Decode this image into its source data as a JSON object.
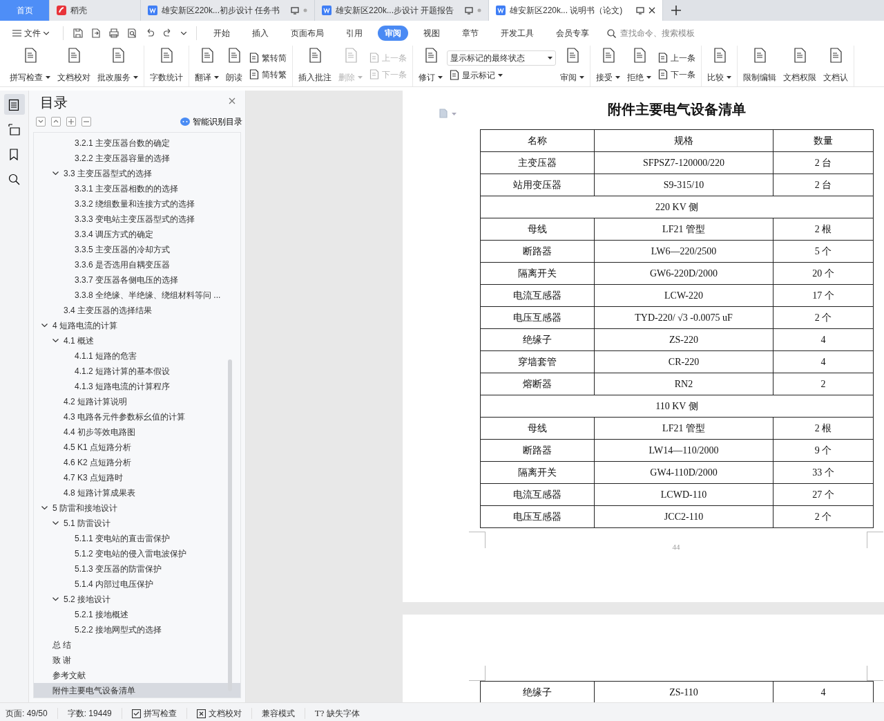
{
  "tabs": [
    {
      "kind": "home",
      "label": "首页",
      "selected": false
    },
    {
      "kind": "app",
      "label": "稻壳",
      "selected": false
    },
    {
      "kind": "doc",
      "label": "雄安新区220k...初步设计 任务书",
      "selected": false
    },
    {
      "kind": "doc",
      "label": "雄安新区220k...步设计 开题报告",
      "selected": false
    },
    {
      "kind": "doc",
      "label": "雄安新区220k... 说明书（论文)",
      "selected": true
    }
  ],
  "menubar": {
    "file": "文件",
    "menus": [
      {
        "label": "开始",
        "selected": false
      },
      {
        "label": "插入",
        "selected": false
      },
      {
        "label": "页面布局",
        "selected": false
      },
      {
        "label": "引用",
        "selected": false
      },
      {
        "label": "审阅",
        "selected": true
      },
      {
        "label": "视图",
        "selected": false
      },
      {
        "label": "章节",
        "selected": false
      },
      {
        "label": "开发工具",
        "selected": false
      },
      {
        "label": "会员专享",
        "selected": false
      }
    ],
    "search": {
      "placeholder": "查找命令、搜索模板"
    }
  },
  "ribbon": {
    "groups": [
      {
        "items": [
          {
            "kind": "big",
            "label": "拼写检查",
            "dropdown": true,
            "disabled": false
          },
          {
            "kind": "big",
            "label": "文档校对",
            "dropdown": false,
            "disabled": false
          },
          {
            "kind": "big",
            "label": "批改服务",
            "dropdown": true,
            "disabled": false
          }
        ]
      },
      {
        "items": [
          {
            "kind": "big",
            "label": "字数统计",
            "dropdown": false,
            "disabled": false
          }
        ]
      },
      {
        "items": [
          {
            "kind": "big",
            "label": "翻译",
            "dropdown": true,
            "disabled": false
          },
          {
            "kind": "big",
            "label": "朗读",
            "dropdown": false,
            "disabled": false
          },
          {
            "kind": "stack",
            "buttons": [
              {
                "label": "繁转简",
                "dropdown": false,
                "disabled": false
              },
              {
                "label": "简转繁",
                "dropdown": false,
                "disabled": false
              }
            ]
          }
        ]
      },
      {
        "items": [
          {
            "kind": "big",
            "label": "插入批注",
            "dropdown": false,
            "disabled": false
          },
          {
            "kind": "big",
            "label": "删除",
            "dropdown": true,
            "disabled": true
          },
          {
            "kind": "stack",
            "buttons": [
              {
                "label": "上一条",
                "dropdown": false,
                "disabled": true
              },
              {
                "label": "下一条",
                "dropdown": false,
                "disabled": true
              }
            ]
          }
        ]
      },
      {
        "items": [
          {
            "kind": "big",
            "label": "修订",
            "dropdown": true,
            "disabled": false
          },
          {
            "kind": "select",
            "value": "显示标记的最终状态",
            "button": {
              "label": "显示标记",
              "dropdown": true
            }
          },
          {
            "kind": "big",
            "label": "审阅",
            "dropdown": true,
            "disabled": false
          }
        ]
      },
      {
        "items": [
          {
            "kind": "big",
            "label": "接受",
            "dropdown": true,
            "disabled": false
          },
          {
            "kind": "big",
            "label": "拒绝",
            "dropdown": true,
            "disabled": false
          },
          {
            "kind": "stack",
            "buttons": [
              {
                "label": "上一条",
                "dropdown": false,
                "disabled": false
              },
              {
                "label": "下一条",
                "dropdown": false,
                "disabled": false
              }
            ]
          }
        ]
      },
      {
        "items": [
          {
            "kind": "big",
            "label": "比较",
            "dropdown": true,
            "disabled": false
          }
        ]
      },
      {
        "items": [
          {
            "kind": "big",
            "label": "限制编辑",
            "dropdown": false,
            "disabled": false
          },
          {
            "kind": "big",
            "label": "文档权限",
            "dropdown": false,
            "disabled": false
          },
          {
            "kind": "big",
            "label": "文档认",
            "dropdown": false,
            "disabled": false
          }
        ]
      }
    ]
  },
  "toc": {
    "title": "目录",
    "smart_button": "智能识别目录",
    "items": [
      {
        "children": [
          {
            "children": [
              {
                "label": "3.2.1  主变压器台数的确定",
                "selected": false
              },
              {
                "label": "3.2.2  主变压器容量的选择",
                "selected": false
              }
            ]
          },
          {
            "label": "3.3  主变压器型式的选择",
            "expanded": true,
            "selected": false,
            "children": [
              {
                "label": "3.3.1  主变压器相数的的选择",
                "selected": false
              },
              {
                "label": "3.3.2 绕组数量和连接方式的选择",
                "selected": false
              },
              {
                "label": "3.3.3 变电站主变压器型式的选择",
                "selected": false
              },
              {
                "label": "3.3.4 调压方式的确定",
                "selected": false
              },
              {
                "label": "3.3.5 主变压器的冷却方式",
                "selected": false
              },
              {
                "label": "3.3.6 是否选用自耦变压器",
                "selected": false
              },
              {
                "label": "3.3.7 变压器各侧电压的选择",
                "selected": false
              },
              {
                "label": "3.3.8 全绝缘、半绝缘、绕组材料等问 ...",
                "selected": false
              }
            ]
          },
          {
            "label": "3.4 主变压器的选择结果",
            "selected": false
          }
        ]
      },
      {
        "label": "4  短路电流的计算",
        "expanded": true,
        "selected": false,
        "children": [
          {
            "label": "4.1  概述",
            "expanded": true,
            "selected": false,
            "children": [
              {
                "label": "4.1.1  短路的危害",
                "selected": false
              },
              {
                "label": "4.1.2  短路计算的基本假设",
                "selected": false
              },
              {
                "label": "4.1.3  短路电流的计算程序",
                "selected": false
              }
            ]
          },
          {
            "label": "4.2  短路计算说明",
            "selected": false
          },
          {
            "label": "4.3  电路各元件参数标幺值的计算",
            "selected": false
          },
          {
            "label": "4.4  初步等效电路图",
            "selected": false
          },
          {
            "label": "4.5 K1 点短路分析",
            "selected": false
          },
          {
            "label": "4.6 K2 点短路分析",
            "selected": false
          },
          {
            "label": "4.7 K3 点短路时",
            "selected": false
          },
          {
            "label": "4.8  短路计算成果表",
            "selected": false
          }
        ]
      },
      {
        "label": "5  防雷和接地设计",
        "expanded": true,
        "selected": false,
        "children": [
          {
            "label": "5.1  防雷设计",
            "expanded": true,
            "selected": false,
            "children": [
              {
                "label": "5.1.1 变电站的直击雷保护",
                "selected": false
              },
              {
                "label": "5.1.2  变电站的侵入雷电波保护",
                "selected": false
              },
              {
                "label": "5.1.3  变压器的防雷保护",
                "selected": false
              },
              {
                "label": "5.1.4 内部过电压保护",
                "selected": false
              }
            ]
          },
          {
            "label": "5.2  接地设计",
            "expanded": true,
            "selected": false,
            "children": [
              {
                "label": "5.2.1  接地概述",
                "selected": false
              },
              {
                "label": "5.2.2  接地网型式的选择",
                "selected": false
              }
            ]
          }
        ]
      },
      {
        "label": "总    结",
        "selected": false
      },
      {
        "label": "致    谢",
        "selected": false
      },
      {
        "label": "参考文献",
        "selected": false
      },
      {
        "label": "附件主要电气设备清单",
        "selected": true
      }
    ]
  },
  "document": {
    "title": "附件主要电气设备清单",
    "rows": [
      {
        "kind": "header",
        "cells": [
          "名称",
          "规格",
          "数量"
        ]
      },
      {
        "kind": "item",
        "cells": [
          "主变压器",
          "SFPSZ7-120000/220",
          "2 台"
        ]
      },
      {
        "kind": "item",
        "cells": [
          "站用变压器",
          "S9-315/10",
          "2 台"
        ]
      },
      {
        "kind": "section",
        "label": "220 KV 侧"
      },
      {
        "kind": "item",
        "cells": [
          "母线",
          "LF21 管型",
          "2 根"
        ]
      },
      {
        "kind": "item",
        "cells": [
          "断路器",
          "LW6—220/2500",
          "5 个"
        ]
      },
      {
        "kind": "item",
        "cells": [
          "隔离开关",
          "GW6-220D/2000",
          "20 个"
        ]
      },
      {
        "kind": "item",
        "cells": [
          "电流互感器",
          "LCW-220",
          "17 个"
        ]
      },
      {
        "kind": "item",
        "cells": [
          "电压互感器",
          "TYD-220/ √3  -0.0075 uF",
          "2 个"
        ]
      },
      {
        "kind": "item",
        "cells": [
          "绝缘子",
          "ZS-220",
          "4"
        ]
      },
      {
        "kind": "item",
        "cells": [
          "穿墙套管",
          "CR-220",
          "4"
        ]
      },
      {
        "kind": "item",
        "cells": [
          "熔断器",
          "RN2",
          "2"
        ]
      },
      {
        "kind": "section",
        "label": "110 KV 侧"
      },
      {
        "kind": "item",
        "cells": [
          "母线",
          "LF21 管型",
          "2 根"
        ]
      },
      {
        "kind": "item",
        "cells": [
          "断路器",
          "LW14—110/2000",
          "9 个"
        ]
      },
      {
        "kind": "item",
        "cells": [
          "隔离开关",
          "GW4-110D/2000",
          "33 个"
        ]
      },
      {
        "kind": "item",
        "cells": [
          "电流互感器",
          "LCWD-110",
          "27 个"
        ]
      },
      {
        "kind": "item",
        "cells": [
          "电压互感器",
          "JCC2-110",
          "2 个"
        ]
      }
    ],
    "page_number": "44",
    "next_page_rows": [
      {
        "kind": "item",
        "cells": [
          "绝缘子",
          "ZS-110",
          "4"
        ]
      }
    ]
  },
  "status_bar": [
    {
      "kind": "text",
      "label": "页面: 49/50"
    },
    {
      "kind": "text",
      "label": "字数: 19449"
    },
    {
      "kind": "check",
      "label": "拼写检查"
    },
    {
      "kind": "cross",
      "label": "文档校对"
    },
    {
      "kind": "text",
      "label": "兼容模式"
    },
    {
      "kind": "glyph",
      "icon_text": "T?",
      "label": "缺失字体"
    }
  ]
}
